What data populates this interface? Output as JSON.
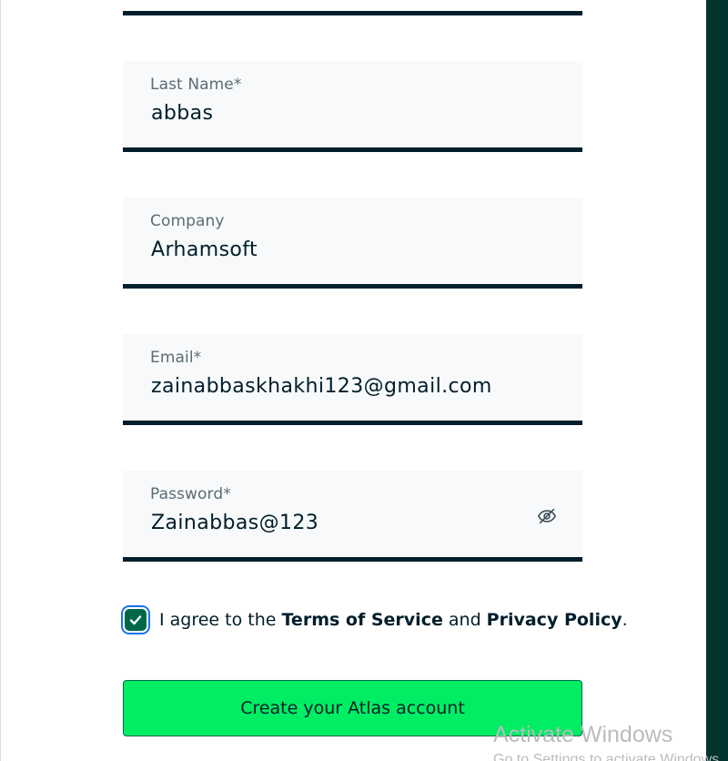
{
  "form": {
    "fields": [
      {
        "label": "Last Name*",
        "value": "abbas"
      },
      {
        "label": "Company",
        "value": "Arhamsoft"
      },
      {
        "label": "Email*",
        "value": "zainabbaskhakhi123@gmail.com"
      },
      {
        "label": "Password*",
        "value": "Zainabbas@123",
        "toggle_icon": "eye-slash-icon"
      }
    ],
    "agreement": {
      "checked": true,
      "text_before": "I agree to the ",
      "terms_label": "Terms of Service",
      "text_middle": " and ",
      "privacy_label": "Privacy Policy",
      "text_after": "."
    },
    "submit_label": "Create your Atlas account"
  },
  "watermark": {
    "title": "Activate Windows",
    "subtitle": "Go to Settings to activate Windows."
  },
  "colors": {
    "field_background": "#f7f9fa",
    "underline": "#001e2b",
    "checkbox": "#00684a",
    "button": "#00ed64",
    "right_bar": "#023430"
  }
}
